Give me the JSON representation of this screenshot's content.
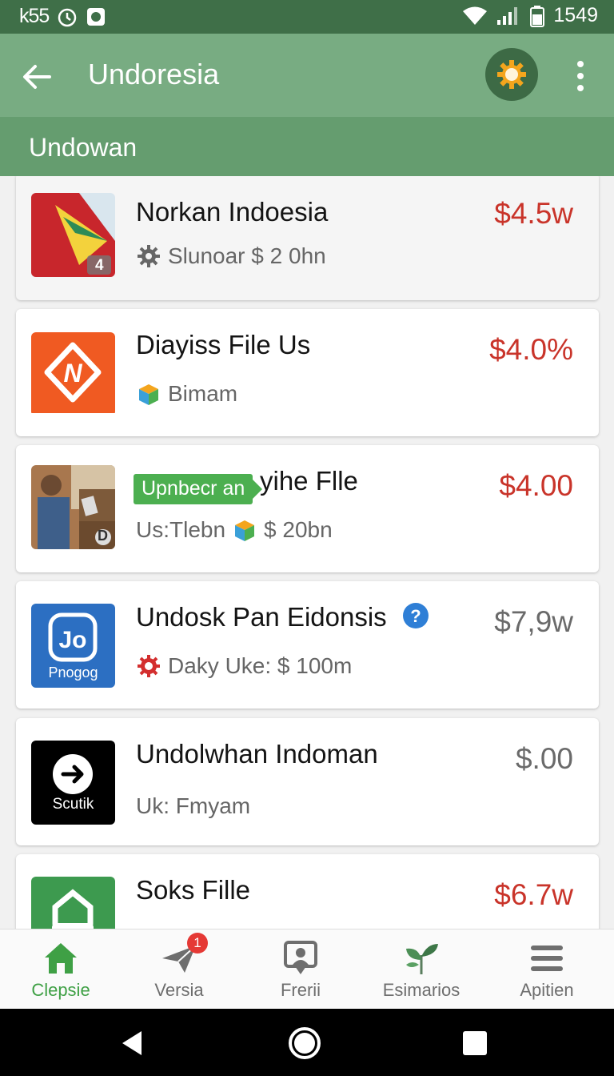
{
  "status_bar": {
    "left_time": "k55",
    "clock": "1549"
  },
  "app_bar": {
    "title": "Undoresia"
  },
  "sub_header": {
    "title": "Undowan"
  },
  "items": [
    {
      "title": "Norkan Indoesia",
      "subtitle": "Slunoar $ 2 0hn",
      "price": "$4.5w",
      "thumb_badge": "4",
      "sub_icon": "gear-icon"
    },
    {
      "title": "Diayiss File Us",
      "subtitle": "Bimam",
      "price": "$4.0%",
      "sub_icon": "box-icon"
    },
    {
      "badge": "Upnbecr an",
      "title": "yihe Flle",
      "subtitle_pre": "Us:Tlebn",
      "subtitle": "$ 20bn",
      "price": "$4.00",
      "thumb_badge": "D",
      "sub_icon": "box-icon"
    },
    {
      "title": "Undosk Pan Eidonsis",
      "subtitle": "Daky Uke: $ 100m",
      "price": "$7,9w",
      "thumb_label": "Pnogog",
      "sub_icon": "red-gear-icon"
    },
    {
      "title": "Undolwhan Indoman",
      "subtitle": "Uk: Fmyam",
      "price": "$.00",
      "thumb_label": "Scutik"
    },
    {
      "title": "Soks Fille",
      "price": "$6.7w"
    }
  ],
  "bottom_nav": [
    {
      "label": "Clepsie",
      "icon": "home-icon",
      "active": true
    },
    {
      "label": "Versia",
      "icon": "send-icon",
      "badge": "1"
    },
    {
      "label": "Frerii",
      "icon": "chat-icon"
    },
    {
      "label": "Esimarios",
      "icon": "plant-icon"
    },
    {
      "label": "Apitien",
      "icon": "list-icon"
    }
  ],
  "colors": {
    "status_bar": "#3f6f48",
    "app_bar": "#78ac82",
    "sub_header": "#659d6f",
    "price_red": "#c9342a",
    "active_green": "#3fa045"
  }
}
